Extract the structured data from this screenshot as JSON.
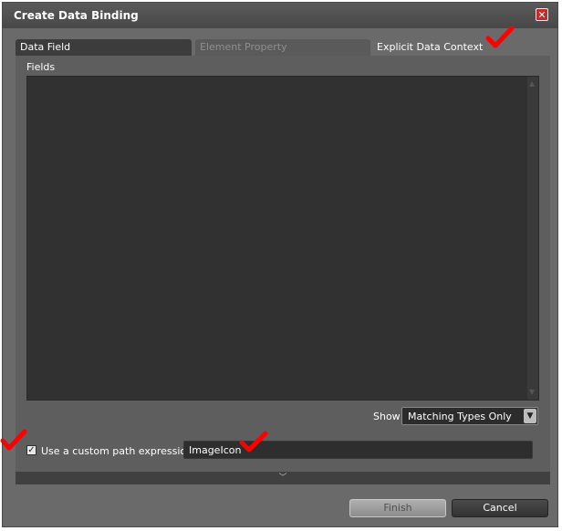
{
  "window": {
    "title": "Create Data Binding",
    "close_glyph": "✕"
  },
  "tabs": [
    {
      "label": "Data Field",
      "state": "enabled"
    },
    {
      "label": "Element Property",
      "state": "disabled"
    },
    {
      "label": "Explicit Data Context",
      "state": "selected"
    }
  ],
  "fields": {
    "label": "Fields"
  },
  "show": {
    "label": "Show",
    "selected": "Matching Types Only"
  },
  "custom_path": {
    "checked": true,
    "check_glyph": "✓",
    "label": "Use a custom path expression",
    "value": "ImageIcon"
  },
  "buttons": {
    "finish": "Finish",
    "cancel": "Cancel"
  },
  "icons": {
    "close": "close-icon",
    "dropdown": "chevron-down-icon",
    "expander": "chevron-down-icon",
    "annotation": "red-checkmark-icon"
  },
  "colors": {
    "annotation_red": "#ff0000",
    "close_red": "#c42a2a"
  }
}
